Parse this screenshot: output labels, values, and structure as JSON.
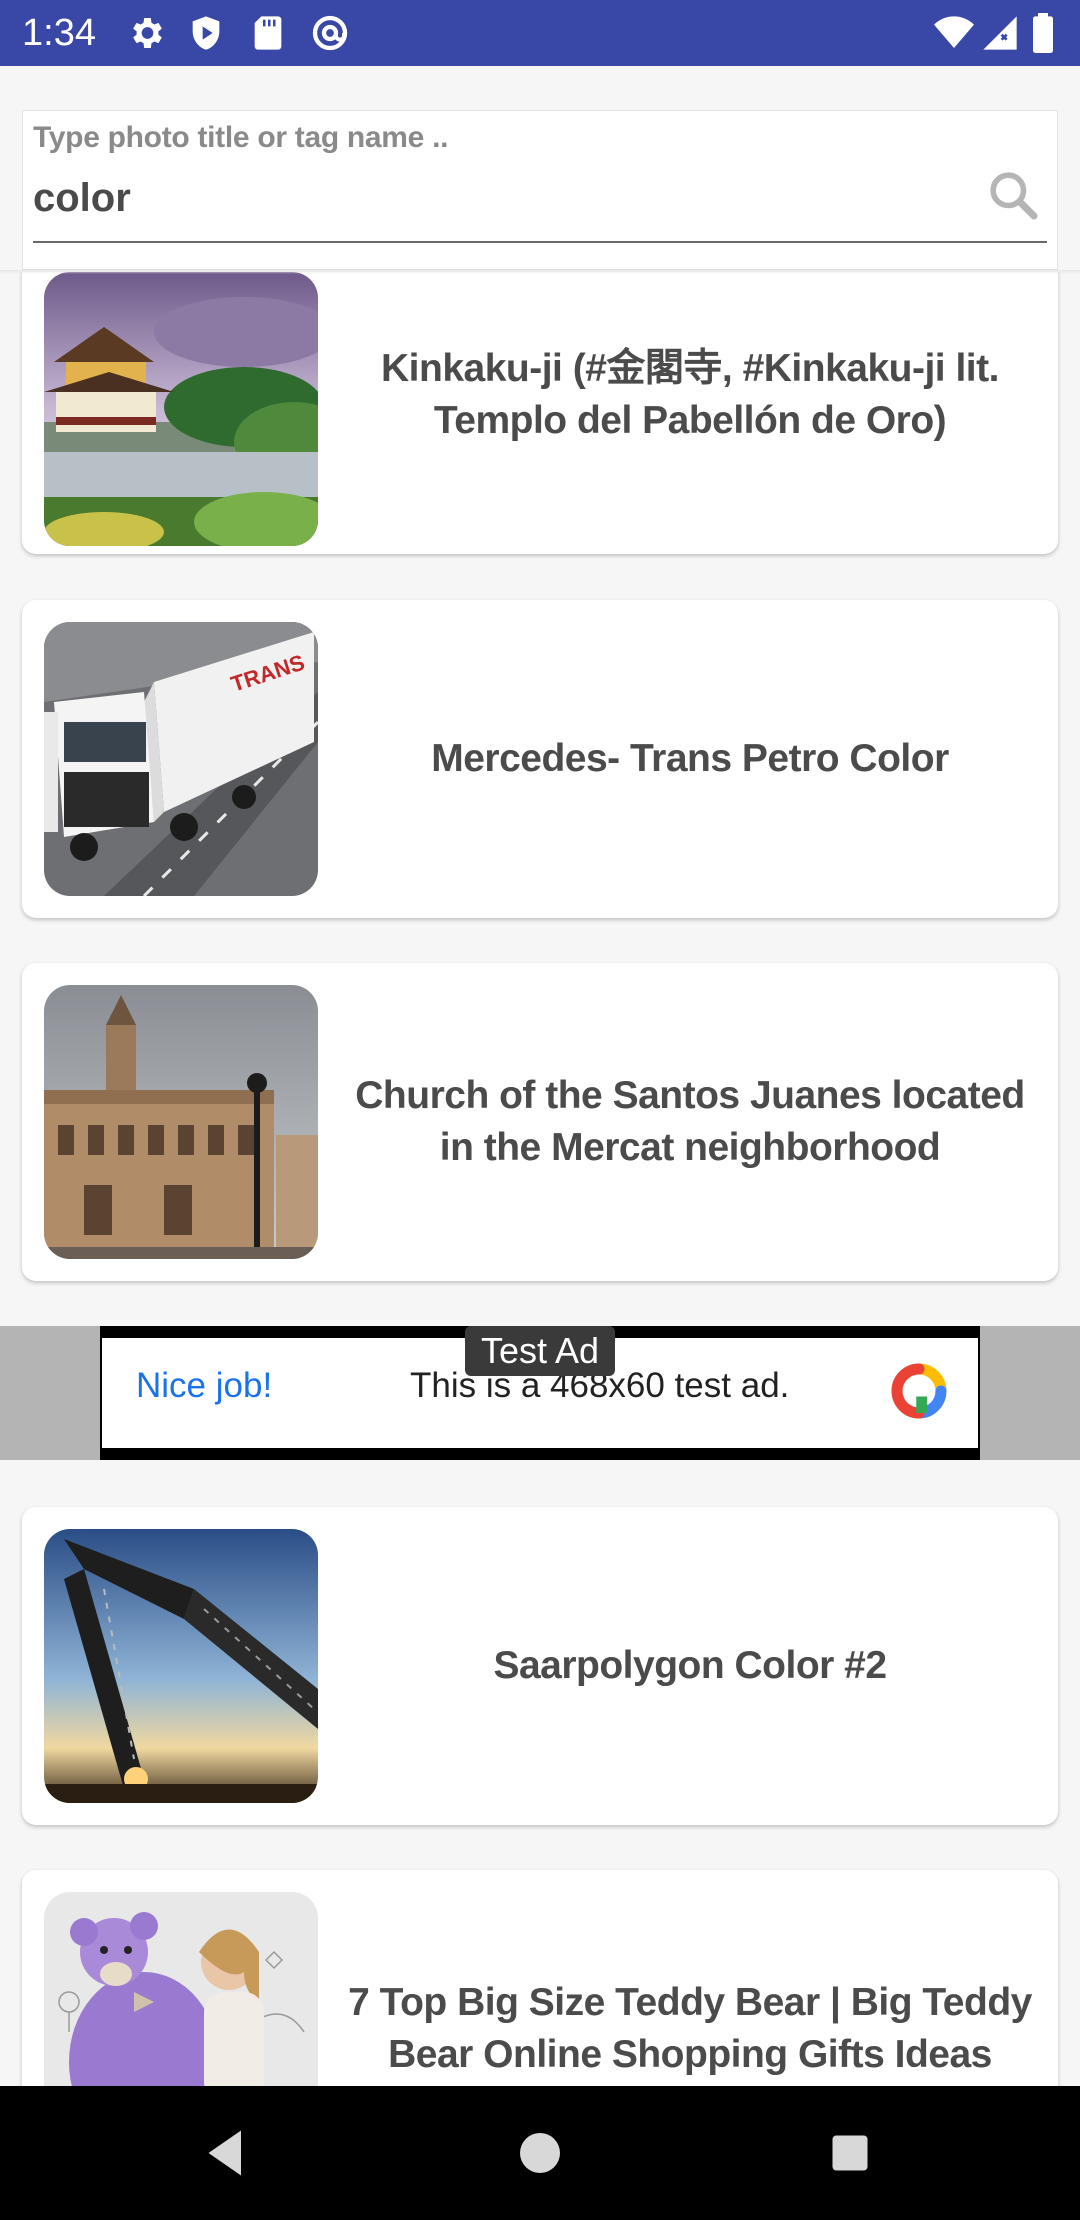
{
  "status_bar": {
    "time": "1:34",
    "icons_left": [
      "settings-icon",
      "shield-icon",
      "sd-card-icon",
      "at-sign-icon"
    ],
    "icons_right": [
      "wifi-icon",
      "signal-icon",
      "battery-icon"
    ],
    "background": "#3947a6"
  },
  "search": {
    "hint": "Type photo title or tag name ..",
    "value": "color",
    "icon": "search-icon"
  },
  "results": [
    {
      "title": "Kinkaku-ji (#金閣寺, #Kinkaku-ji lit. Templo del Pabellón de Oro)",
      "thumb": "temple-pond-photo"
    },
    {
      "title": "Mercedes- Trans Petro Color",
      "thumb": "truck-photo"
    },
    {
      "title": "Church of the Santos Juanes located in the Mercat neighborhood",
      "thumb": "church-photo"
    },
    {
      "title": "Saarpolygon Color #2",
      "thumb": "steel-sculpture-sunset-photo"
    },
    {
      "title": "7 Top Big Size Teddy Bear | Big Teddy Bear Online Shopping Gifts Ideas",
      "thumb": "teddy-bear-girl-photo"
    }
  ],
  "ad": {
    "label": "Test Ad",
    "cta": "Nice job!",
    "text": "This is a 468x60 test ad.",
    "cta_color": "#1a73e8"
  },
  "nav": {
    "back": "back-icon",
    "home": "home-icon",
    "recents": "recents-icon"
  }
}
